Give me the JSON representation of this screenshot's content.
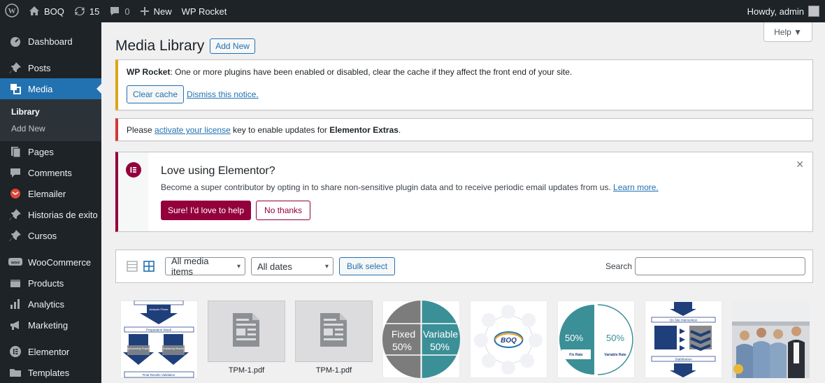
{
  "adminbar": {
    "site_name": "BOQ",
    "updates_count": "15",
    "comments_count": "0",
    "new_label": "New",
    "wp_rocket_label": "WP Rocket",
    "howdy": "Howdy, admin"
  },
  "sidebar": {
    "items": [
      {
        "label": "Dashboard",
        "icon": "dashboard-icon"
      },
      {
        "label": "Posts",
        "icon": "pin-icon"
      },
      {
        "label": "Media",
        "icon": "media-icon"
      },
      {
        "label": "Pages",
        "icon": "pages-icon"
      },
      {
        "label": "Comments",
        "icon": "comments-icon"
      },
      {
        "label": "Elemailer",
        "icon": "elemailer-icon"
      },
      {
        "label": "Historias de exito",
        "icon": "pin-icon"
      },
      {
        "label": "Cursos",
        "icon": "pin-icon"
      },
      {
        "label": "WooCommerce",
        "icon": "woo-icon"
      },
      {
        "label": "Products",
        "icon": "products-icon"
      },
      {
        "label": "Analytics",
        "icon": "analytics-icon"
      },
      {
        "label": "Marketing",
        "icon": "megaphone-icon"
      },
      {
        "label": "Elementor",
        "icon": "elementor-icon"
      },
      {
        "label": "Templates",
        "icon": "folder-icon"
      }
    ],
    "media_submenu": [
      "Library",
      "Add New"
    ]
  },
  "help_label": "Help ▼",
  "page": {
    "title": "Media Library",
    "add_new": "Add New"
  },
  "notices": {
    "rocket": {
      "brand": "WP Rocket",
      "text": ": One or more plugins have been enabled or disabled, clear the cache if they affect the front end of your site.",
      "clear_cache": "Clear cache",
      "dismiss": "Dismiss this notice."
    },
    "license": {
      "before": "Please ",
      "link": "activate your license",
      "middle": " key to enable updates for ",
      "product": "Elementor Extras",
      "after": "."
    },
    "elementor": {
      "title": "Love using Elementor?",
      "desc": "Become a super contributor by opting in to share non-sensitive plugin data and to receive periodic email updates from us.",
      "learn_more": "Learn more.",
      "accept": "Sure! I'd love to help",
      "decline": "No thanks"
    }
  },
  "toolbar": {
    "filter_type": "All media items",
    "filter_date": "All dates",
    "bulk_select": "Bulk select",
    "search_label": "Search"
  },
  "attachments": {
    "a1": {
      "labels": [
        "Analysis Phase",
        "Preparation Week",
        "Implementing Projects",
        "Sustaining Results",
        "Final Results Validation"
      ]
    },
    "a2": {
      "filename": "TPM-1.pdf"
    },
    "a3": {
      "filename": "TPM-1.pdf"
    },
    "a4": {
      "left_word": "Fixed",
      "left_pct": "50%",
      "right_word": "Variable",
      "right_pct": "50%"
    },
    "a5": {
      "center": "BOQ"
    },
    "a6": {
      "left_pct": "50%",
      "right_pct": "50%",
      "left_label": "Fix Rate",
      "right_label": "Variable Rate"
    },
    "a7": {
      "labels": [
        "On Site Intervention",
        "Stabilization"
      ]
    }
  },
  "colors": {
    "adminbar_bg": "#1d2327",
    "menu_active": "#2271b1",
    "elementor_brand": "#93003c",
    "teal": "#3b8f96",
    "grey_chart": "#7c7c7c"
  }
}
